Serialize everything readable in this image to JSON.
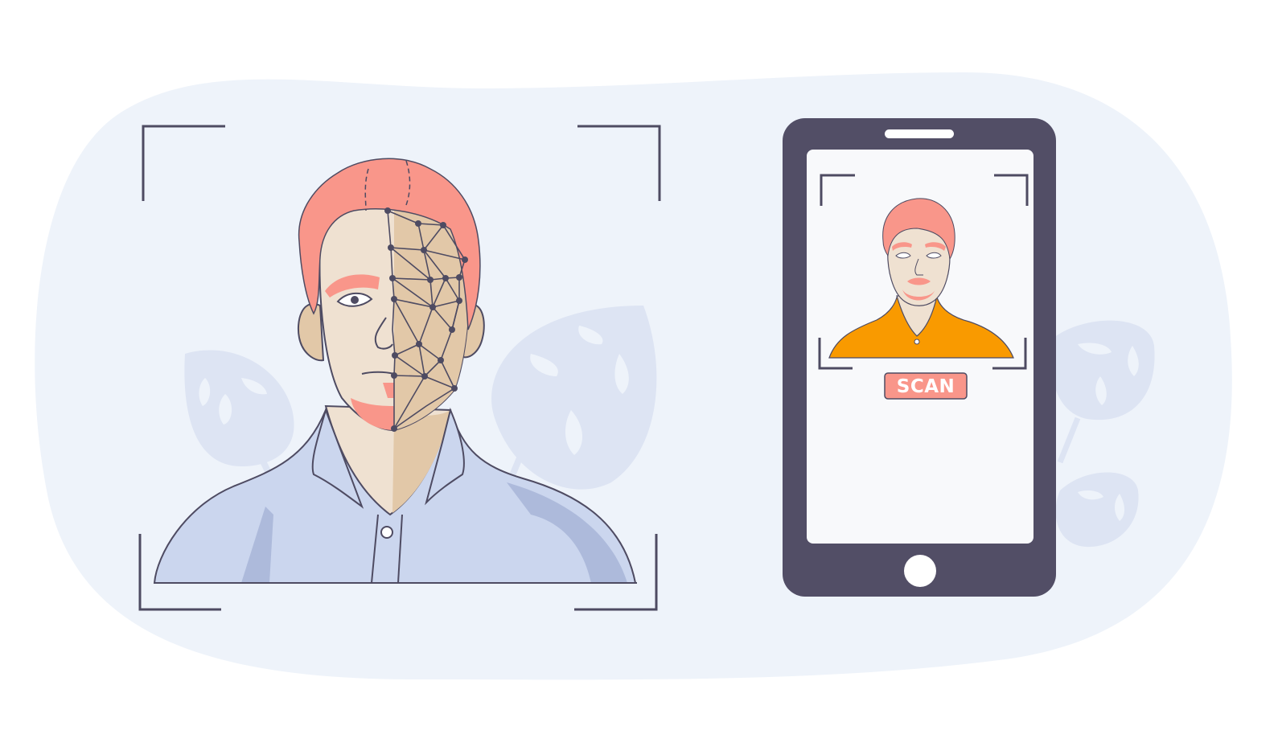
{
  "phone": {
    "scan_button_label": "SCAN"
  },
  "icons": {
    "phone": "smartphone-icon",
    "home_button": "home-button-icon",
    "speaker": "speaker-slot-icon"
  },
  "colors": {
    "background_blob": "#eef3fa",
    "leaf": "#dde4f3",
    "frame_stroke": "#4e4b62",
    "phone_body": "#524e66",
    "phone_screen": "#f8f9fb",
    "hair": "#f9968a",
    "skin": "#efe1d1",
    "skin_shadow": "#e2c8a8",
    "shirt": "#cbd6ee",
    "shirt_shadow": "#adbadb",
    "mini_shirt": "#f99a00",
    "scan_button": "#f9968a",
    "scan_text": "#ffffff"
  }
}
